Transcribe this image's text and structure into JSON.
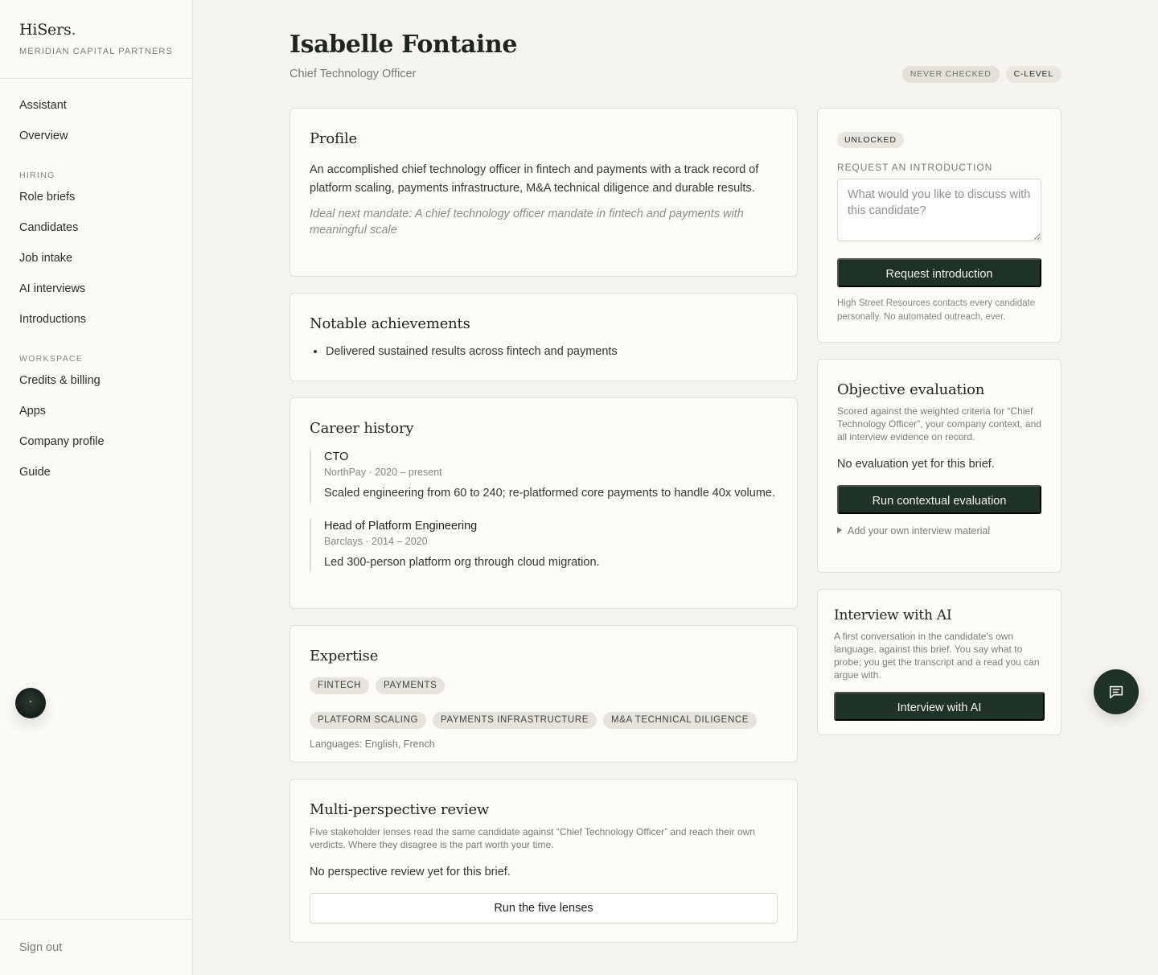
{
  "brand": {
    "name": "HiSers",
    "dot": ".",
    "org": "MERIDIAN CAPITAL PARTNERS"
  },
  "nav": {
    "top": [
      "Assistant",
      "Overview"
    ],
    "hiring_label": "HIRING",
    "hiring": [
      "Role briefs",
      "Candidates",
      "Job intake",
      "AI interviews",
      "Introductions"
    ],
    "workspace_label": "WORKSPACE",
    "workspace": [
      "Credits & billing",
      "Apps",
      "Company profile",
      "Guide"
    ],
    "signout": "Sign out"
  },
  "candidate": {
    "name": "Isabelle Fontaine",
    "title": "Chief Technology Officer",
    "badges": {
      "status": "NEVER CHECKED",
      "level": "C-LEVEL"
    }
  },
  "profile": {
    "heading": "Profile",
    "summary": "An accomplished chief technology officer in fintech and payments with a track record of platform scaling, payments infrastructure, M&A technical diligence and durable results.",
    "mandate": "Ideal next mandate: A chief technology officer mandate in fintech and payments with meaningful scale"
  },
  "achievements": {
    "heading": "Notable achievements",
    "items": [
      "Delivered sustained results across fintech and payments"
    ]
  },
  "career": {
    "heading": "Career history",
    "jobs": [
      {
        "role": "CTO",
        "meta": "NorthPay · 2020 – present",
        "desc": "Scaled engineering from 60 to 240; re-platformed core payments to handle 40x volume."
      },
      {
        "role": "Head of Platform Engineering",
        "meta": "Barclays · 2014 – 2020",
        "desc": "Led 300-person platform org through cloud migration."
      }
    ]
  },
  "expertise": {
    "heading": "Expertise",
    "tags": [
      "FINTECH",
      "PAYMENTS",
      "PLATFORM SCALING",
      "PAYMENTS INFRASTRUCTURE",
      "M&A TECHNICAL DILIGENCE"
    ],
    "languages": "Languages: English, French"
  },
  "review": {
    "heading": "Multi-perspective review",
    "description": "Five stakeholder lenses read the same candidate against “Chief Technology Officer” and reach their own verdicts. Where they disagree is the part worth your time.",
    "empty": "No perspective review yet for this brief.",
    "button": "Run the five lenses"
  },
  "intro": {
    "chip": "UNLOCKED",
    "label": "REQUEST AN INTRODUCTION",
    "placeholder": "What would you like to discuss with this candidate?",
    "button": "Request introduction",
    "note": "High Street Resources contacts every candidate personally. No automated outreach, ever."
  },
  "evaluation": {
    "heading": "Objective evaluation",
    "description": "Scored against the weighted criteria for “Chief Technology Officer”, your company context, and all interview evidence on record.",
    "empty": "No evaluation yet for this brief.",
    "button": "Run contextual evaluation",
    "toggle": "Add your own interview material"
  },
  "ai_interview": {
    "heading": "Interview with AI",
    "description": "A first conversation in the candidate's own language, against this brief. You say what to probe; you get the transcript and a read you can argue with.",
    "button": "Interview with AI"
  },
  "icons": {
    "assistant_orb": "assistant-orb-icon",
    "chat": "chat-icon",
    "disclosure": "triangle-right-icon"
  },
  "colors": {
    "accent": "#1f3226",
    "background": "#f5f4ef",
    "sidebar": "#fbfaf6"
  }
}
